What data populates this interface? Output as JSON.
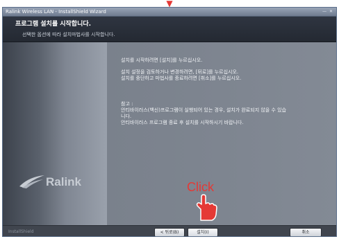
{
  "window": {
    "title": "Ralink Wireless LAN - InstallShield Wizard",
    "controls": "—  ✕"
  },
  "header": {
    "title": "프로그램 설치를 시작합니다.",
    "subtitle": "선택한 옵션에 따라 설치마법사를 시작합니다."
  },
  "content": {
    "line1": "설치를 시작하려면 [설치]를 누르십시오.",
    "line2": "설치 설정을 검토하거나 변경하려면, [뒤로]를 누르십시오.",
    "line3": "설치를 중단하고 마법사를 종료하려면 [취소]를 누르십시오.",
    "note_label": "참고 :",
    "note_line1": "안티바이러스(백신)프로그램이 실행되어 있는 경우, 설치가 완료되지 않을 수 있습",
    "note_line2": "니다.",
    "note_line3": "안티바이러스 프로그램 종료 후 설치를 시작하시기 바랍니다."
  },
  "logo": {
    "text": "Ralink"
  },
  "footer": {
    "brand": "InstallShield"
  },
  "buttons": {
    "back": "< 뒤로(B)",
    "next": "설치(I)",
    "cancel": "취소"
  },
  "annotation": {
    "click_text": "Click",
    "arrow": "▼"
  },
  "colors": {
    "annotation": "#e53935",
    "header_bg": "#2b3039",
    "panel_bg": "#7e8590"
  }
}
